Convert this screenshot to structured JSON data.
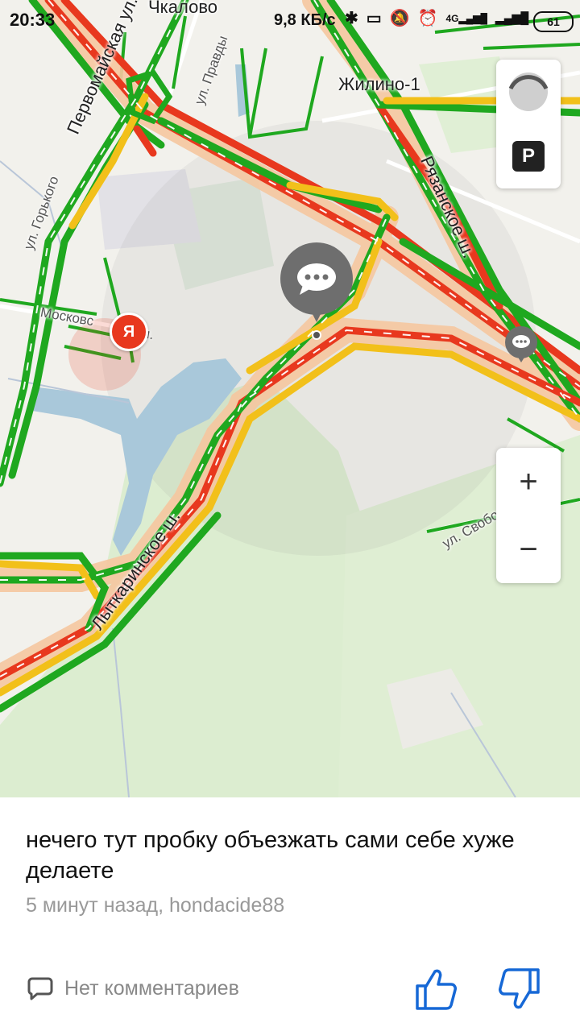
{
  "status_bar": {
    "time": "20:33",
    "network_speed": "9,8 КБ/с",
    "signal_label": "4G",
    "battery": "61"
  },
  "map": {
    "labels": {
      "chkalovo": "Чкалово",
      "zhilino": "Жилино-1",
      "pervomayskaya": "Первомайская ул.",
      "pravdy": "ул. Правды",
      "gorkogo": "ул. Горького",
      "moskovskaya": "Московс",
      "moskovskaya_tail": "л.",
      "ryazanskoe": "Рязанское ш.",
      "lytkarinskoe": "Лыткаринское ш.",
      "svobody": "ул. Свободы"
    },
    "yandex_marker": "Я",
    "controls": {
      "parking_label": "P",
      "zoom_in": "+",
      "zoom_out": "−"
    }
  },
  "comment_panel": {
    "text": "нечего тут пробку объезжать сами себе хуже делаете",
    "meta": "5 минут назад, hondacide88",
    "comments_label": "Нет комментариев"
  },
  "colors": {
    "traffic_red": "#e8381e",
    "traffic_yellow": "#f2c01a",
    "traffic_green": "#1fa81f",
    "water": "#a9c8da",
    "park": "#d6ebc9",
    "thumb_blue": "#1668d6"
  }
}
